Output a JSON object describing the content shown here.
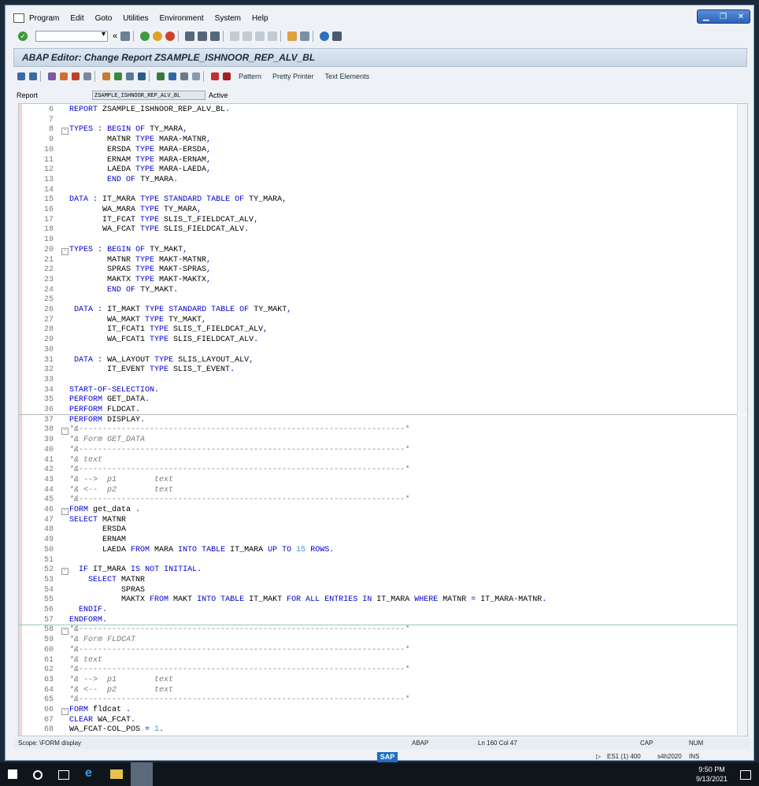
{
  "menu": [
    "Program",
    "Edit",
    "Goto",
    "Utilities",
    "Environment",
    "System",
    "Help"
  ],
  "screen_title": "ABAP Editor: Change Report ZSAMPLE_ISHNOOR_REP_ALV_BL",
  "app_toolbar": {
    "pattern": "Pattern",
    "pretty_printer": "Pretty Printer",
    "text_elements": "Text Elements"
  },
  "report": {
    "label": "Report",
    "value": "ZSAMPLE_ISHNOOR_REP_ALV_BL",
    "status": "Active"
  },
  "code_lines": [
    {
      "n": "6",
      "t": "REPORT ZSAMPLE_ISHNOOR_REP_ALV_BL."
    },
    {
      "n": "7",
      "t": ""
    },
    {
      "n": "8",
      "t": "TYPES : BEGIN OF TY_MARA,",
      "f": 1
    },
    {
      "n": "9",
      "t": "        MATNR TYPE MARA-MATNR,"
    },
    {
      "n": "10",
      "t": "        ERSDA TYPE MARA-ERSDA,"
    },
    {
      "n": "11",
      "t": "        ERNAM TYPE MARA-ERNAM,"
    },
    {
      "n": "12",
      "t": "        LAEDA TYPE MARA-LAEDA,"
    },
    {
      "n": "13",
      "t": "        END OF TY_MARA."
    },
    {
      "n": "14",
      "t": ""
    },
    {
      "n": "15",
      "t": "DATA : IT_MARA TYPE STANDARD TABLE OF TY_MARA,"
    },
    {
      "n": "16",
      "t": "       WA_MARA TYPE TY_MARA,"
    },
    {
      "n": "17",
      "t": "       IT_FCAT TYPE SLIS_T_FIELDCAT_ALV,"
    },
    {
      "n": "18",
      "t": "       WA_FCAT TYPE SLIS_FIELDCAT_ALV."
    },
    {
      "n": "19",
      "t": ""
    },
    {
      "n": "20",
      "t": "TYPES : BEGIN OF TY_MAKT,",
      "f": 1
    },
    {
      "n": "21",
      "t": "        MATNR TYPE MAKT-MATNR,"
    },
    {
      "n": "22",
      "t": "        SPRAS TYPE MAKT-SPRAS,"
    },
    {
      "n": "23",
      "t": "        MAKTX TYPE MAKT-MAKTX,"
    },
    {
      "n": "24",
      "t": "        END OF TY_MAKT."
    },
    {
      "n": "25",
      "t": ""
    },
    {
      "n": "26",
      "t": " DATA : IT_MAKT TYPE STANDARD TABLE OF TY_MAKT,"
    },
    {
      "n": "27",
      "t": "        WA_MAKT TYPE TY_MAKT,"
    },
    {
      "n": "28",
      "t": "        IT_FCAT1 TYPE SLIS_T_FIELDCAT_ALV,"
    },
    {
      "n": "29",
      "t": "        WA_FCAT1 TYPE SLIS_FIELDCAT_ALV."
    },
    {
      "n": "30",
      "t": ""
    },
    {
      "n": "31",
      "t": " DATA : WA_LAYOUT TYPE SLIS_LAYOUT_ALV,"
    },
    {
      "n": "32",
      "t": "        IT_EVENT TYPE SLIS_T_EVENT."
    },
    {
      "n": "33",
      "t": ""
    },
    {
      "n": "34",
      "t": "START-OF-SELECTION."
    },
    {
      "n": "35",
      "t": "PERFORM GET_DATA."
    },
    {
      "n": "36",
      "t": "PERFORM FLDCAT."
    },
    {
      "n": "37",
      "t": "PERFORM DISPLAY."
    },
    {
      "n": "38",
      "t": "*&---------------------------------------------------------------------*",
      "f": 1
    },
    {
      "n": "39",
      "t": "*& Form GET_DATA"
    },
    {
      "n": "40",
      "t": "*&---------------------------------------------------------------------*"
    },
    {
      "n": "41",
      "t": "*& text"
    },
    {
      "n": "42",
      "t": "*&---------------------------------------------------------------------*"
    },
    {
      "n": "43",
      "t": "*& -->  p1        text"
    },
    {
      "n": "44",
      "t": "*& <--  p2        text"
    },
    {
      "n": "45",
      "t": "*&---------------------------------------------------------------------*"
    },
    {
      "n": "46",
      "t": "FORM get_data .",
      "f": 1
    },
    {
      "n": "47",
      "t": "SELECT MATNR"
    },
    {
      "n": "48",
      "t": "       ERSDA"
    },
    {
      "n": "49",
      "t": "       ERNAM"
    },
    {
      "n": "50",
      "t": "       LAEDA FROM MARA INTO TABLE IT_MARA UP TO 15 ROWS."
    },
    {
      "n": "51",
      "t": ""
    },
    {
      "n": "52",
      "t": "  IF IT_MARA IS NOT INITIAL.",
      "f": 1
    },
    {
      "n": "53",
      "t": "    SELECT MATNR"
    },
    {
      "n": "54",
      "t": "           SPRAS"
    },
    {
      "n": "55",
      "t": "           MAKTX FROM MAKT INTO TABLE IT_MAKT FOR ALL ENTRIES IN IT_MARA WHERE MATNR = IT_MARA-MATNR."
    },
    {
      "n": "56",
      "t": "  ENDIF."
    },
    {
      "n": "57",
      "t": "ENDFORM."
    },
    {
      "n": "58",
      "t": "*&---------------------------------------------------------------------*",
      "f": 1
    },
    {
      "n": "59",
      "t": "*& Form FLDCAT"
    },
    {
      "n": "60",
      "t": "*&---------------------------------------------------------------------*"
    },
    {
      "n": "61",
      "t": "*& text"
    },
    {
      "n": "62",
      "t": "*&---------------------------------------------------------------------*"
    },
    {
      "n": "63",
      "t": "*& -->  p1        text"
    },
    {
      "n": "64",
      "t": "*& <--  p2        text"
    },
    {
      "n": "65",
      "t": "*&---------------------------------------------------------------------*"
    },
    {
      "n": "66",
      "t": "FORM fldcat .",
      "f": 1
    },
    {
      "n": "67",
      "t": "CLEAR WA_FCAT."
    },
    {
      "n": "68",
      "t": "WA_FCAT-COL_POS = 1."
    }
  ],
  "status_bar": {
    "scope": "Scope: \\FORM display",
    "lang": "ABAP",
    "position": "Ln 160 Col  47",
    "caps": "CAP",
    "num": "NUM"
  },
  "footer": {
    "system": "ES1 (1) 400",
    "server": "s4h2020",
    "mode": "INS",
    "logo": "SAP"
  },
  "taskbar": {
    "time": "9:50 PM",
    "date": "9/13/2021"
  },
  "colors": {
    "keyword": "#0000d0",
    "comment": "#7a7a7a",
    "number": "#4a8de0"
  }
}
